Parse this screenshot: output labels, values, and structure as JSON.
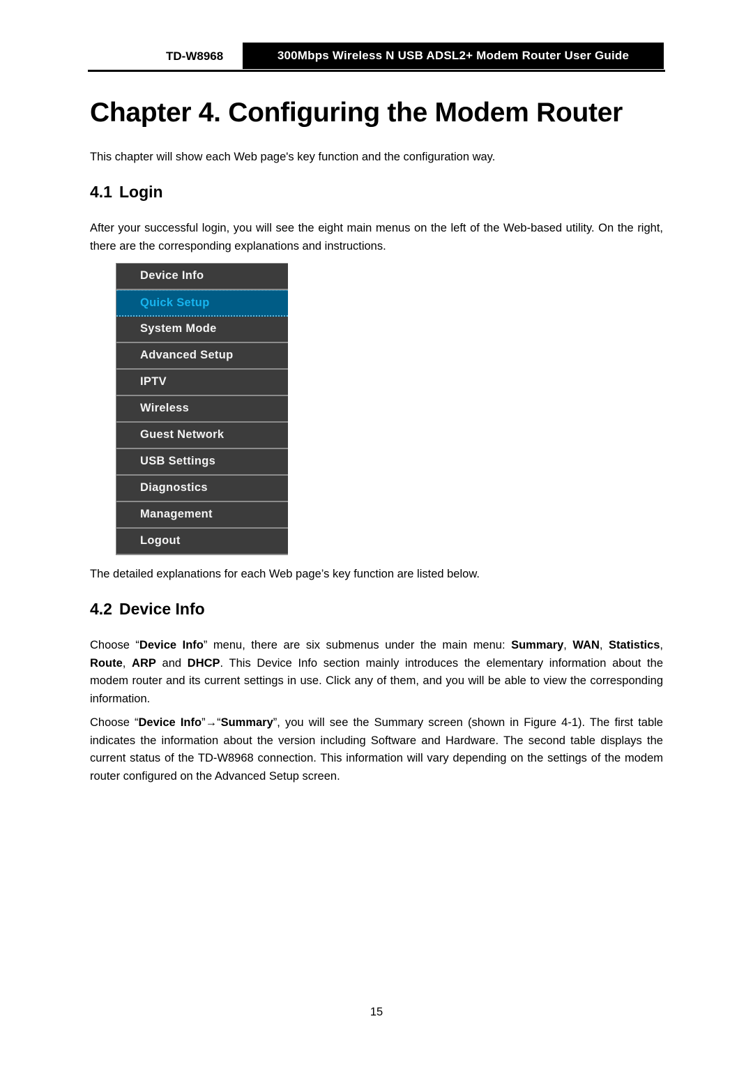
{
  "header": {
    "model": "TD-W8968",
    "guide_title": "300Mbps Wireless N USB ADSL2+ Modem Router User Guide"
  },
  "chapter_title": "Chapter 4. Configuring the Modem Router",
  "intro": "This chapter will show each Web page's key function and the configuration way.",
  "section_login": {
    "number": "4.1",
    "title": "Login",
    "paragraph": "After your successful login, you will see the eight main menus on the left of the Web-based utility. On the right, there are the corresponding explanations and instructions.",
    "menu": {
      "active_index": 1,
      "items": [
        {
          "label": "Device Info"
        },
        {
          "label": "Quick Setup"
        },
        {
          "label": "System Mode"
        },
        {
          "label": "Advanced Setup"
        },
        {
          "label": "IPTV"
        },
        {
          "label": "Wireless"
        },
        {
          "label": "Guest Network"
        },
        {
          "label": "USB Settings"
        },
        {
          "label": "Diagnostics"
        },
        {
          "label": "Management"
        },
        {
          "label": "Logout"
        }
      ]
    },
    "after_menu": "The detailed explanations for each Web page’s key function are listed below."
  },
  "section_device_info": {
    "number": "4.2",
    "title": "Device Info",
    "para1": {
      "t1": "Choose “",
      "b1": "Device Info",
      "t2": "” menu, there are six submenus under the main menu: ",
      "b2": "Summary",
      "t3": ", ",
      "b3": "WAN",
      "t4": ", ",
      "b4": "Statistics",
      "t5": ", ",
      "b5": "Route",
      "t6": ", ",
      "b6": "ARP",
      "t7": " and ",
      "b7": "DHCP",
      "t8": ". This Device Info section mainly introduces the elementary information about the modem router and its current settings in use. Click any of them, and you will be able to view the corresponding information."
    },
    "para2": {
      "t1": "Choose “",
      "b1": "Device Info",
      "t2": "”→“",
      "b2": "Summary",
      "t3": "”, you will see the Summary screen (shown in Figure 4-1). The first table indicates the information about the version including Software and Hardware. The second table displays the current status of the TD-W8968 connection. This information will vary depending on the settings of the modem router configured on the Advanced Setup screen."
    }
  },
  "page_number": "15",
  "colors": {
    "menu_bg": "#3c3c3c",
    "menu_active_bg": "#005c86",
    "menu_active_text": "#17b4ee",
    "menu_divider": "#8c8c8c"
  }
}
